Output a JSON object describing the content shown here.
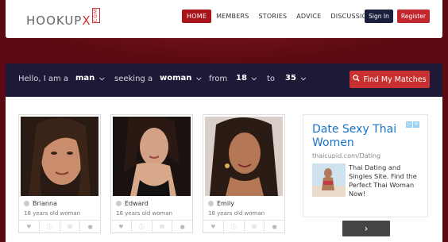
{
  "brand": {
    "logo_main": "HOOKUP",
    "logo_accent": "X",
    "logo_suffix": "COM"
  },
  "nav": {
    "items": [
      {
        "label": "HOME",
        "active": true
      },
      {
        "label": "MEMBERS",
        "active": false
      },
      {
        "label": "STORIES",
        "active": false
      },
      {
        "label": "ADVICE",
        "active": false
      },
      {
        "label": "DISCUSSIONS",
        "active": false
      }
    ],
    "signin": "Sign In",
    "register": "Register"
  },
  "search": {
    "intro": "Hello, I am a",
    "gender": "man",
    "seeking_label": "seeking a",
    "seeking": "woman",
    "from_label": "from",
    "age_from": "18",
    "to_label": "to",
    "age_to": "35",
    "button": "Find My Matches"
  },
  "profiles": [
    {
      "name": "Brianna",
      "age_text": "18 years old woman"
    },
    {
      "name": "Edward",
      "age_text": "18 years old woman"
    },
    {
      "name": "Emily",
      "age_text": "18 years old woman"
    }
  ],
  "ad": {
    "title": "Date Sexy Thai Women",
    "url": "thaicupid.com/Dating",
    "description": "Thai Dating and Singles Site. Find the Perfect Thai Woman Now!",
    "button_icon": "chevron-right-icon"
  },
  "colors": {
    "brand_red": "#c8312f",
    "nav_active": "#a8141a",
    "dark_navy": "#1d1a38",
    "background": "#5a0a10",
    "ad_link": "#1a73c9"
  }
}
